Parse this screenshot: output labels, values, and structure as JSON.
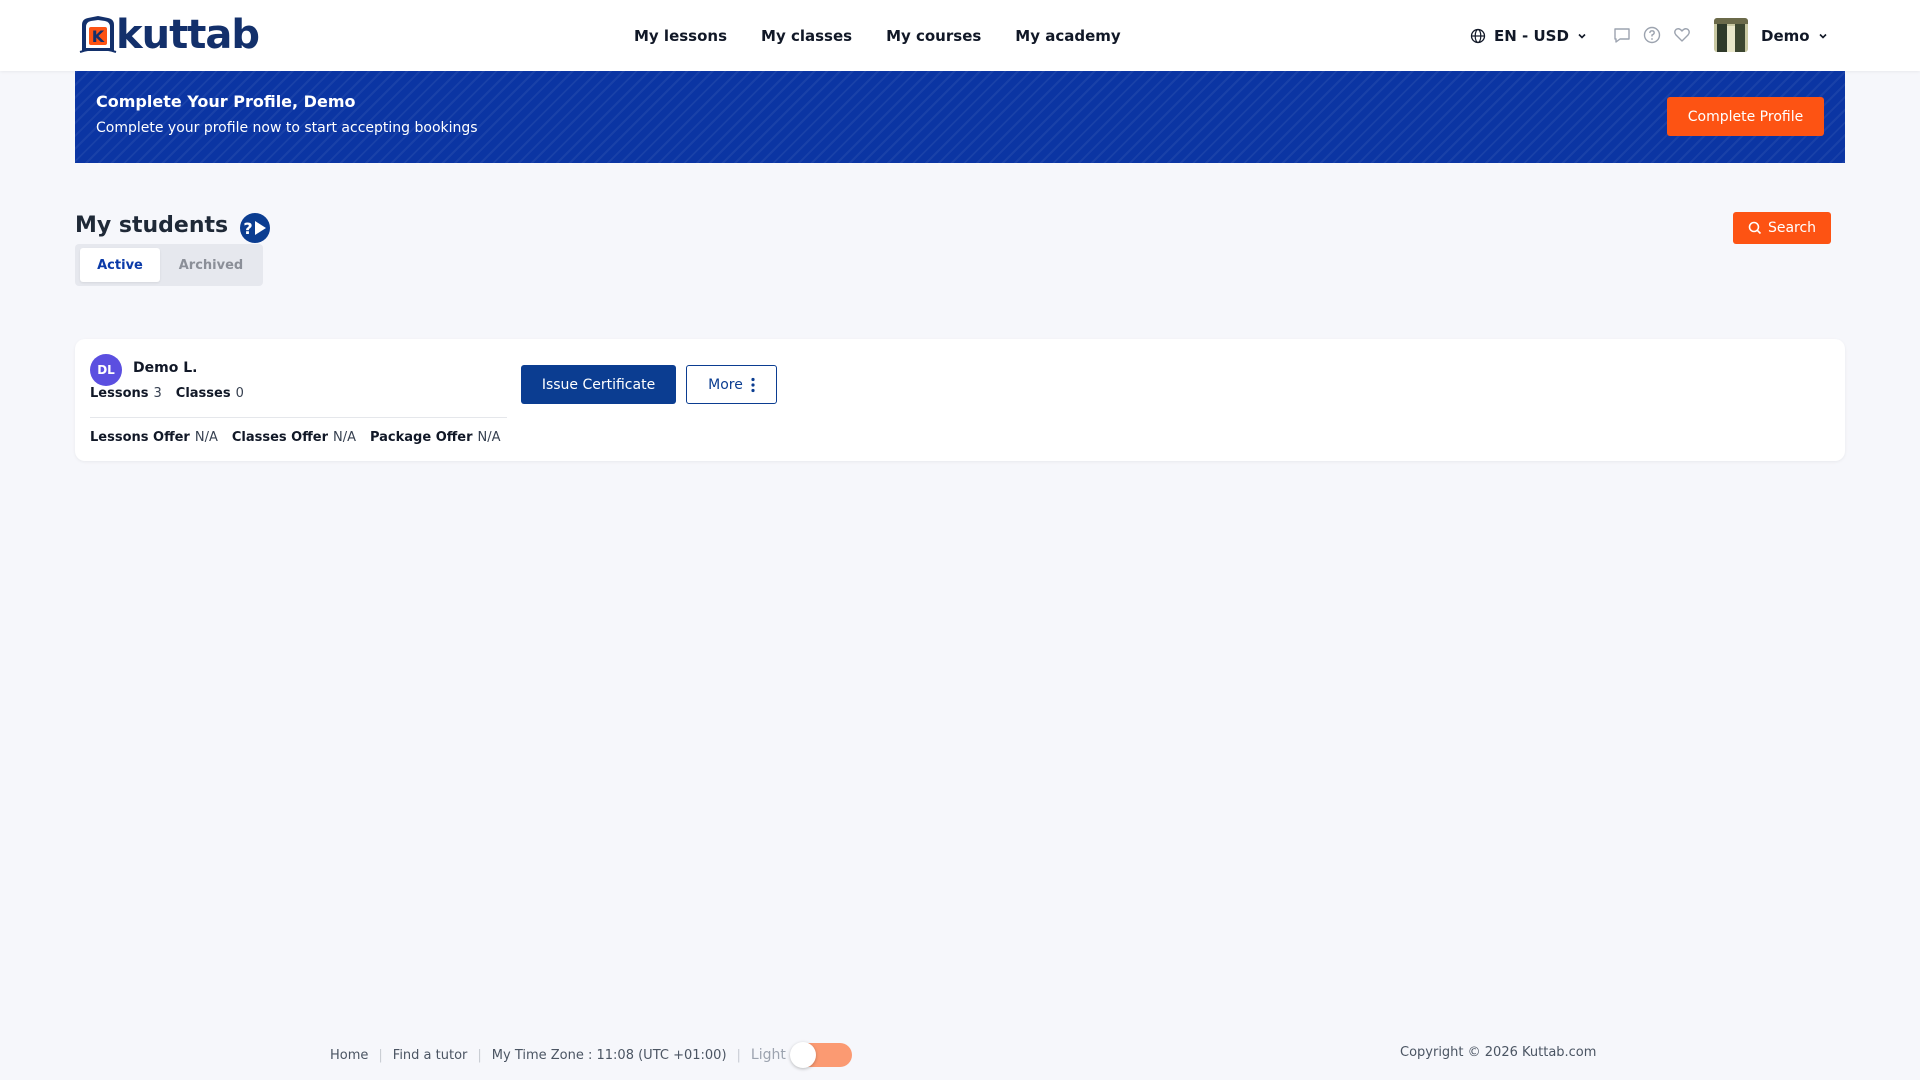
{
  "header": {
    "logo_text": "kuttab",
    "nav": [
      "My lessons",
      "My classes",
      "My courses",
      "My academy"
    ],
    "language_currency": "EN - USD",
    "user_name": "Demo"
  },
  "banner": {
    "title": "Complete Your Profile, Demo",
    "subtitle": "Complete your profile now to start accepting bookings",
    "button": "Complete Profile"
  },
  "page": {
    "title": "My students",
    "search_button": "Search",
    "tabs": [
      "Active",
      "Archived"
    ],
    "active_tab": "Active"
  },
  "students": [
    {
      "initials": "DL",
      "name": "Demo L.",
      "lessons_label": "Lessons",
      "lessons": "3",
      "classes_label": "Classes",
      "classes": "0",
      "lessons_offer_label": "Lessons Offer",
      "lessons_offer": "N/A",
      "classes_offer_label": "Classes Offer",
      "classes_offer": "N/A",
      "package_offer_label": "Package Offer",
      "package_offer": "N/A",
      "issue_button": "Issue Certificate",
      "more_button": "More"
    }
  ],
  "footer": {
    "links": [
      "Home",
      "Find a tutor"
    ],
    "timezone": "My Time Zone : 11:08 (UTC +01:00)",
    "theme_label": "Light",
    "copyright": "Copyright © 2026 Kuttab.com"
  },
  "colors": {
    "brand_blue": "#0b35a3",
    "dark_blue": "#0b3d91",
    "accent_orange": "#fd5313",
    "avatar_purple": "#5b4fe0"
  },
  "icons": [
    "globe-icon",
    "chevron-down-icon",
    "chat-icon",
    "help-circle-icon",
    "heart-icon",
    "search-icon",
    "play-help-icon",
    "more-vertical-icon"
  ]
}
